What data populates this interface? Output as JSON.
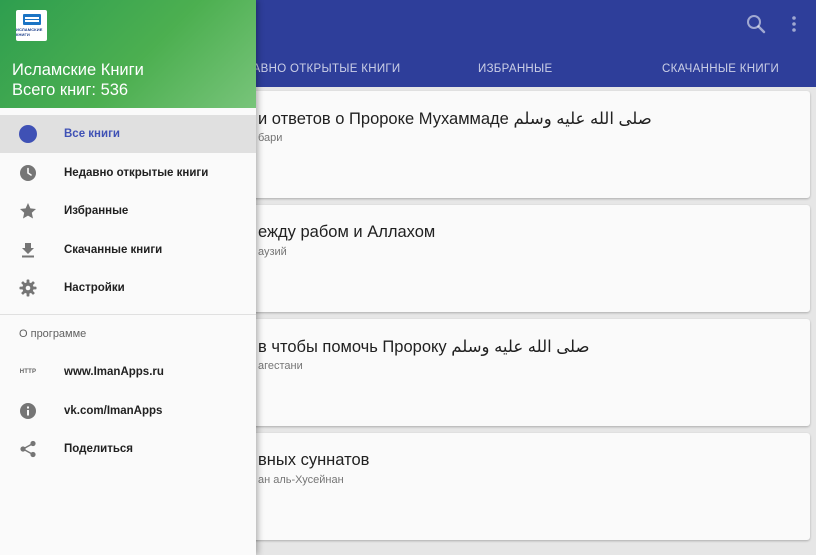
{
  "colors": {
    "appbar": "#2e3e9a",
    "drawer_header": "#4caf50",
    "accent": "#3f51b5",
    "active_row": "#e0e0e0"
  },
  "appbar": {
    "search_icon": "search-icon",
    "more_icon": "more-vert-icon",
    "tabs": [
      {
        "label": "НЕДАВНО ОТКРЫТЫЕ КНИГИ"
      },
      {
        "label": "ИЗБРАННЫЕ"
      },
      {
        "label": "СКАЧАННЫЕ КНИГИ"
      }
    ]
  },
  "books": [
    {
      "title": "и ответов о Пророке Мухаммаде صلى الله عليه وسلم",
      "author": "бари"
    },
    {
      "title": "ежду рабом и Аллахом",
      "author": "аузий"
    },
    {
      "title": "в чтобы помочь Пророку صلى الله عليه وسلم",
      "author": "агестани"
    },
    {
      "title": "вных суннатов",
      "author": "ан аль-Хусейнан"
    }
  ],
  "drawer": {
    "logo_text": "ИСЛАМСКИЕ КНИГИ",
    "title": "Исламские Книги",
    "count": "Всего книг: 536",
    "items": [
      {
        "label": "Все книги",
        "icon": "circle-icon"
      },
      {
        "label": "Недавно открытые книги",
        "icon": "clock-icon"
      },
      {
        "label": "Избранные",
        "icon": "star-icon"
      },
      {
        "label": "Скачанные книги",
        "icon": "download-icon"
      },
      {
        "label": "Настройки",
        "icon": "gear-icon"
      }
    ],
    "section_label": "О программе",
    "about_items": [
      {
        "label": "www.ImanApps.ru",
        "icon": "http-icon",
        "icon_text": "HTTP"
      },
      {
        "label": "vk.com/ImanApps",
        "icon": "info-icon"
      },
      {
        "label": "Поделиться",
        "icon": "share-icon"
      }
    ]
  }
}
